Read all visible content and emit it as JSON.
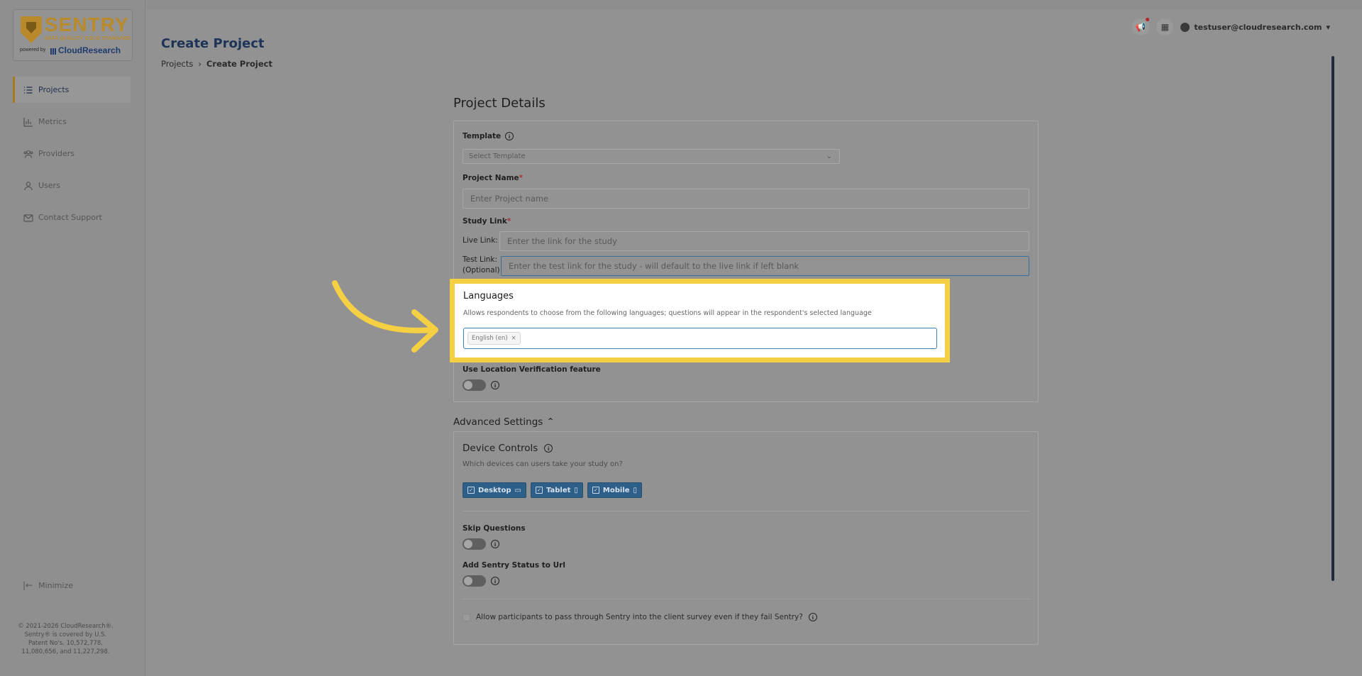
{
  "brand": {
    "name": "SENTRY",
    "tagline": "DATA QUALITY GOLD STANDARD",
    "powered_by": "powered by",
    "partner": "CloudResearch"
  },
  "sidebar": {
    "items": [
      {
        "label": "Projects",
        "icon": "list-icon",
        "active": true
      },
      {
        "label": "Metrics",
        "icon": "chart-icon",
        "active": false
      },
      {
        "label": "Providers",
        "icon": "users-group-icon",
        "active": false
      },
      {
        "label": "Users",
        "icon": "user-icon",
        "active": false
      },
      {
        "label": "Contact Support",
        "icon": "mail-icon",
        "active": false
      }
    ],
    "minimize_label": "Minimize",
    "copyright": "© 2021-2026 CloudResearch®. Sentry® is covered by U.S. Patent No's. 10,572,778, 11,080,656, and 11,227,298."
  },
  "header": {
    "title": "Create Project",
    "breadcrumb": [
      "Projects",
      "Create Project"
    ],
    "user_email": "testuser@cloudresearch.com"
  },
  "form": {
    "section_title": "Project Details",
    "template_label": "Template",
    "template_placeholder": "Select Template",
    "project_name_label": "Project Name",
    "project_name_placeholder": "Enter Project name",
    "study_link_label": "Study Link",
    "live_link_label": "Live Link:",
    "live_link_placeholder": "Enter the link for the study",
    "test_link_label_1": "Test Link:",
    "test_link_label_2": "(Optional)",
    "test_link_placeholder": "Enter the test link for the study - will default to the live link if left blank",
    "required_marker": "*",
    "languages": {
      "title": "Languages",
      "description": "Allows respondents to choose from the following languages; questions will appear in the respondent's selected language",
      "selected": [
        "English (en)"
      ]
    },
    "location_label": "Use Location Verification feature"
  },
  "advanced": {
    "label": "Advanced Settings",
    "device_title": "Device Controls",
    "device_desc": "Which devices can users take your study on?",
    "devices": [
      "Desktop",
      "Tablet",
      "Mobile"
    ],
    "skip_label": "Skip Questions",
    "status_label": "Add Sentry Status to Url",
    "pass_label": "Allow participants to pass through Sentry into the client survey even if they fail Sentry?"
  },
  "colors": {
    "highlight": "#f5d042",
    "brand_gold": "#b98a2b",
    "title_navy": "#1e3358",
    "device_blue": "#2e5f88"
  }
}
